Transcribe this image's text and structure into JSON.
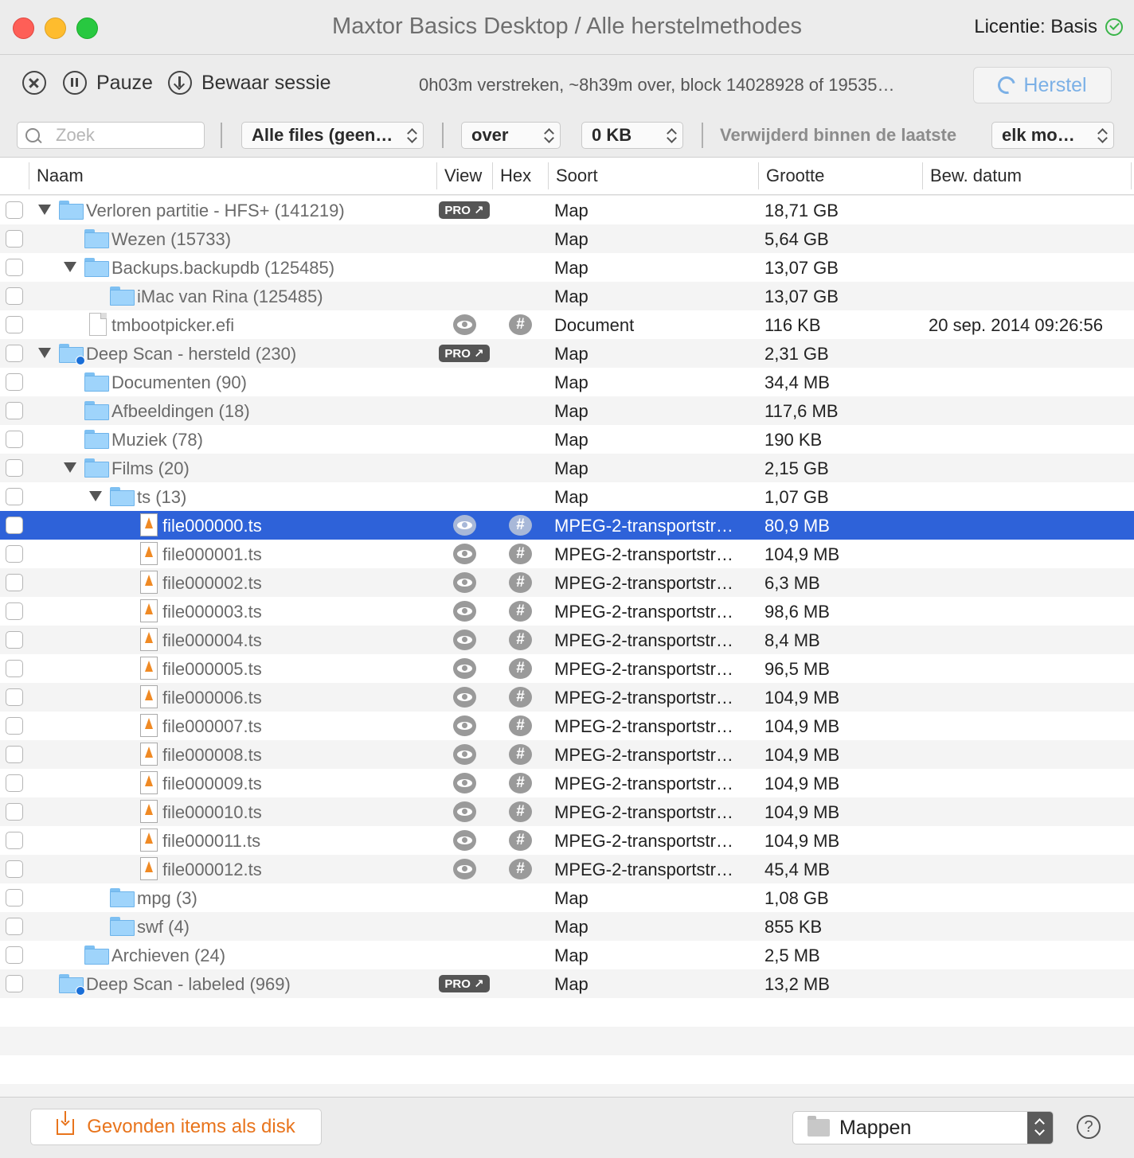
{
  "window": {
    "title": "Maxtor Basics Desktop / Alle herstelmethodes",
    "license": "Licentie: Basis"
  },
  "toolbar": {
    "pause_label": "Pauze",
    "save_session_label": "Bewaar sessie",
    "progress_text": "0h03m verstreken, ~8h39m over, block 14028928 of 19535…",
    "recover_label": "Herstel"
  },
  "filters": {
    "search_placeholder": "Zoek",
    "file_type": "Alle files (geen…",
    "size_comparator": "over",
    "size_value": "0 KB",
    "deleted_label": "Verwijderd binnen de laatste",
    "deleted_period": "elk mo…"
  },
  "columns": {
    "name": "Naam",
    "view": "View",
    "hex": "Hex",
    "kind": "Soort",
    "size": "Grootte",
    "date": "Bew. datum"
  },
  "pro_badge": "PRO ↗",
  "hash_glyph": "#",
  "rows": [
    {
      "name": "Verloren partitie - HFS+ (141219)",
      "kind": "Map",
      "size": "18,71 GB",
      "date": "",
      "level": 0,
      "icon": "folder-icon",
      "expand": "open",
      "pro": true,
      "actions": false
    },
    {
      "name": "Wezen (15733)",
      "kind": "Map",
      "size": "5,64 GB",
      "date": "",
      "level": 1,
      "icon": "folder-icon",
      "expand": "closed",
      "pro": false,
      "actions": false
    },
    {
      "name": "Backups.backupdb (125485)",
      "kind": "Map",
      "size": "13,07 GB",
      "date": "",
      "level": 1,
      "icon": "folder-icon",
      "expand": "open",
      "pro": false,
      "actions": false
    },
    {
      "name": "iMac van Rina (125485)",
      "kind": "Map",
      "size": "13,07 GB",
      "date": "",
      "level": 2,
      "icon": "folder-icon",
      "expand": "closed",
      "pro": false,
      "actions": false
    },
    {
      "name": "tmbootpicker.efi",
      "kind": "Document",
      "size": "116 KB",
      "date": "20 sep. 2014 09:26:56",
      "level": 1,
      "icon": "document-icon",
      "expand": "",
      "pro": false,
      "actions": true
    },
    {
      "name": "Deep Scan - hersteld (230)",
      "kind": "Map",
      "size": "2,31 GB",
      "date": "",
      "level": 0,
      "icon": "scan-folder-icon",
      "expand": "open",
      "pro": true,
      "actions": false
    },
    {
      "name": "Documenten (90)",
      "kind": "Map",
      "size": "34,4 MB",
      "date": "",
      "level": 1,
      "icon": "folder-icon",
      "expand": "closed",
      "pro": false,
      "actions": false
    },
    {
      "name": "Afbeeldingen (18)",
      "kind": "Map",
      "size": "117,6 MB",
      "date": "",
      "level": 1,
      "icon": "folder-icon",
      "expand": "closed",
      "pro": false,
      "actions": false
    },
    {
      "name": "Muziek (78)",
      "kind": "Map",
      "size": "190 KB",
      "date": "",
      "level": 1,
      "icon": "folder-icon",
      "expand": "closed",
      "pro": false,
      "actions": false
    },
    {
      "name": "Films (20)",
      "kind": "Map",
      "size": "2,15 GB",
      "date": "",
      "level": 1,
      "icon": "folder-icon",
      "expand": "open",
      "pro": false,
      "actions": false
    },
    {
      "name": "ts (13)",
      "kind": "Map",
      "size": "1,07 GB",
      "date": "",
      "level": 2,
      "icon": "folder-icon",
      "expand": "open",
      "pro": false,
      "actions": false
    },
    {
      "name": "file000000.ts",
      "kind": "MPEG-2-transportstr…",
      "size": "80,9 MB",
      "date": "",
      "level": 3,
      "icon": "mpeg-file-icon",
      "expand": "",
      "pro": false,
      "actions": true,
      "selected": true
    },
    {
      "name": "file000001.ts",
      "kind": "MPEG-2-transportstr…",
      "size": "104,9 MB",
      "date": "",
      "level": 3,
      "icon": "mpeg-file-icon",
      "expand": "",
      "pro": false,
      "actions": true
    },
    {
      "name": "file000002.ts",
      "kind": "MPEG-2-transportstr…",
      "size": "6,3 MB",
      "date": "",
      "level": 3,
      "icon": "mpeg-file-icon",
      "expand": "",
      "pro": false,
      "actions": true
    },
    {
      "name": "file000003.ts",
      "kind": "MPEG-2-transportstr…",
      "size": "98,6 MB",
      "date": "",
      "level": 3,
      "icon": "mpeg-file-icon",
      "expand": "",
      "pro": false,
      "actions": true
    },
    {
      "name": "file000004.ts",
      "kind": "MPEG-2-transportstr…",
      "size": "8,4 MB",
      "date": "",
      "level": 3,
      "icon": "mpeg-file-icon",
      "expand": "",
      "pro": false,
      "actions": true
    },
    {
      "name": "file000005.ts",
      "kind": "MPEG-2-transportstr…",
      "size": "96,5 MB",
      "date": "",
      "level": 3,
      "icon": "mpeg-file-icon",
      "expand": "",
      "pro": false,
      "actions": true
    },
    {
      "name": "file000006.ts",
      "kind": "MPEG-2-transportstr…",
      "size": "104,9 MB",
      "date": "",
      "level": 3,
      "icon": "mpeg-file-icon",
      "expand": "",
      "pro": false,
      "actions": true
    },
    {
      "name": "file000007.ts",
      "kind": "MPEG-2-transportstr…",
      "size": "104,9 MB",
      "date": "",
      "level": 3,
      "icon": "mpeg-file-icon",
      "expand": "",
      "pro": false,
      "actions": true
    },
    {
      "name": "file000008.ts",
      "kind": "MPEG-2-transportstr…",
      "size": "104,9 MB",
      "date": "",
      "level": 3,
      "icon": "mpeg-file-icon",
      "expand": "",
      "pro": false,
      "actions": true
    },
    {
      "name": "file000009.ts",
      "kind": "MPEG-2-transportstr…",
      "size": "104,9 MB",
      "date": "",
      "level": 3,
      "icon": "mpeg-file-icon",
      "expand": "",
      "pro": false,
      "actions": true
    },
    {
      "name": "file000010.ts",
      "kind": "MPEG-2-transportstr…",
      "size": "104,9 MB",
      "date": "",
      "level": 3,
      "icon": "mpeg-file-icon",
      "expand": "",
      "pro": false,
      "actions": true
    },
    {
      "name": "file000011.ts",
      "kind": "MPEG-2-transportstr…",
      "size": "104,9 MB",
      "date": "",
      "level": 3,
      "icon": "mpeg-file-icon",
      "expand": "",
      "pro": false,
      "actions": true
    },
    {
      "name": "file000012.ts",
      "kind": "MPEG-2-transportstr…",
      "size": "45,4 MB",
      "date": "",
      "level": 3,
      "icon": "mpeg-file-icon",
      "expand": "",
      "pro": false,
      "actions": true
    },
    {
      "name": "mpg (3)",
      "kind": "Map",
      "size": "1,08 GB",
      "date": "",
      "level": 2,
      "icon": "folder-icon",
      "expand": "closed",
      "pro": false,
      "actions": false
    },
    {
      "name": "swf (4)",
      "kind": "Map",
      "size": "855 KB",
      "date": "",
      "level": 2,
      "icon": "folder-icon",
      "expand": "closed",
      "pro": false,
      "actions": false
    },
    {
      "name": "Archieven (24)",
      "kind": "Map",
      "size": "2,5 MB",
      "date": "",
      "level": 1,
      "icon": "folder-icon",
      "expand": "closed",
      "pro": false,
      "actions": false
    },
    {
      "name": "Deep Scan - labeled (969)",
      "kind": "Map",
      "size": "13,2 MB",
      "date": "",
      "level": 0,
      "icon": "scan-folder-icon",
      "expand": "closed",
      "pro": true,
      "actions": false
    }
  ],
  "footer": {
    "disk_button_label": "Gevonden items als disk",
    "view_mode": "Mappen",
    "help": "?"
  },
  "colors": {
    "accent": "#2e62d9",
    "orange": "#e8741c",
    "recover_text": "#7bb0e6"
  }
}
